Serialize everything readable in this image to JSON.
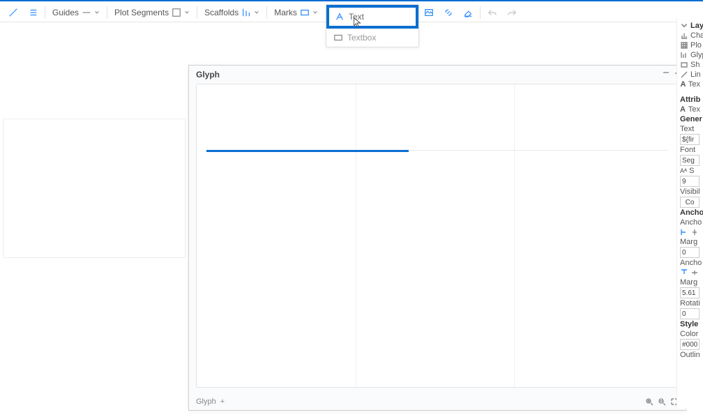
{
  "toolbar": {
    "guides": "Guides",
    "plot_segments": "Plot Segments",
    "scaffolds": "Scaffolds",
    "marks": "Marks"
  },
  "popup": {
    "text_item": "Text",
    "textbox_item": "Textbox"
  },
  "glyph_panel": {
    "title": "Glyph",
    "footer_label": "Glyph"
  },
  "layers": {
    "header": "Layers",
    "chart": "Chart",
    "plot": "Plo",
    "glyph": "Glyph",
    "shape": "Sh",
    "line": "Lin",
    "text": "Tex"
  },
  "attributes": {
    "header": "Attrib",
    "text_label_top": "Tex",
    "general_header": "Gener",
    "text_label": "Text",
    "text_value": "${fir",
    "font_label": "Font",
    "font_value": "Seg",
    "font_size": "9",
    "font_style": "S",
    "visibility_label": "Visibil",
    "visibility_btn": "Co",
    "anchor_header": "Ancho",
    "anchor_label": "Ancho",
    "margin_label": "Marg",
    "margin_value": "0",
    "anchor2_label": "Ancho",
    "margin2_label": "Marg",
    "margin2_value": "5.61",
    "rotation_label": "Rotati",
    "rotation_value": "0",
    "style_header": "Style",
    "color_label": "Color",
    "color_value": "#000",
    "outline_label": "Outlin"
  }
}
